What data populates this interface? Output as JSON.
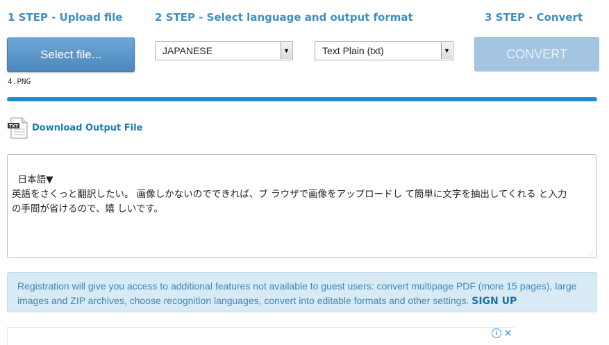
{
  "steps": {
    "step1": "1 STEP - Upload file",
    "step2": "2 STEP - Select language and output format",
    "step3": "3 STEP - Convert"
  },
  "upload": {
    "select_label": "Select file...",
    "filename": "4.PNG"
  },
  "language": {
    "selected": "JAPANESE"
  },
  "format": {
    "selected": "Text Plain (txt)"
  },
  "convert": {
    "label": "CONVERT",
    "state": "disabled"
  },
  "progress": {
    "percent": 100,
    "color": "#1a8fd0"
  },
  "download": {
    "icon_label": "TXT",
    "label": "Download Output File"
  },
  "output_text": "日本語▼\n英語をさくっと翻訳したい。 画像しかないのでできれば、ブ ラウザで画像をアップロードし て簡単に文字を抽出してくれる と入力\nの手間が省けるので、嬉 しいです。",
  "info": {
    "text": "Registration will give you access to additional features not available to guest users: convert multipage PDF (more 15 pages), large images and ZIP archives, choose recognition languages, convert into editable formats and other settings. ",
    "signup": "SIGN UP"
  },
  "ad": {
    "info_icon": "i",
    "close_icon": "✕"
  },
  "colors": {
    "accent": "#3f8fc1",
    "button": "#5a96c9",
    "button_disabled": "#a4c5e1",
    "info_bg": "#d8ebf5"
  }
}
